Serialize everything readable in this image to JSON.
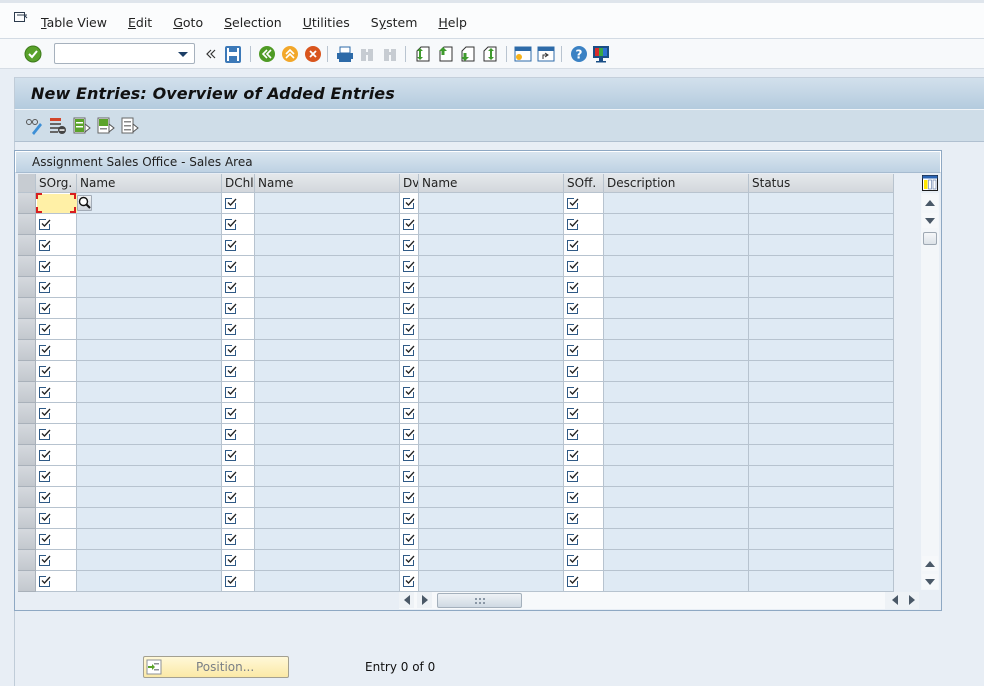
{
  "menubar": {
    "items": [
      {
        "label": "Table View",
        "mnemonic": "T"
      },
      {
        "label": "Edit",
        "mnemonic": "E"
      },
      {
        "label": "Goto",
        "mnemonic": "G"
      },
      {
        "label": "Selection",
        "mnemonic": "S"
      },
      {
        "label": "Utilities",
        "mnemonic": "U"
      },
      {
        "label": "System",
        "mnemonic": "y"
      },
      {
        "label": "Help",
        "mnemonic": "H"
      }
    ]
  },
  "toolbar": {
    "command_field_value": "",
    "icons": [
      "enter-icon",
      "command-field",
      "collapse-icon",
      "save-icon",
      "back-icon",
      "exit-icon",
      "cancel-icon",
      "print-icon",
      "find-icon",
      "find-next-icon",
      "first-page-icon",
      "previous-page-icon",
      "next-page-icon",
      "last-page-icon",
      "create-session-icon",
      "shortcut-icon",
      "help-icon",
      "customize-layout-icon"
    ]
  },
  "page": {
    "title": "New Entries: Overview of Added Entries"
  },
  "app_toolbar": {
    "icons": [
      "display-change-icon",
      "delete-icon",
      "select-all-icon",
      "select-block-icon",
      "deselect-all-icon"
    ]
  },
  "table": {
    "title": "Assignment Sales Office - Sales Area",
    "columns": [
      {
        "key": "sorg",
        "label": "SOrg."
      },
      {
        "key": "sorg_name",
        "label": "Name"
      },
      {
        "key": "dchl",
        "label": "DChl"
      },
      {
        "key": "dchl_name",
        "label": "Name"
      },
      {
        "key": "dv",
        "label": "Dv"
      },
      {
        "key": "dv_name",
        "label": "Name"
      },
      {
        "key": "soff",
        "label": "SOff."
      },
      {
        "key": "description",
        "label": "Description"
      },
      {
        "key": "status",
        "label": "Status"
      }
    ],
    "row_count": 19,
    "rows": [],
    "focused_cell": {
      "row": 0,
      "column": "SOrg."
    }
  },
  "footer": {
    "position_button": "Position...",
    "entry_text": "Entry 0 of 0"
  },
  "colors": {
    "background": "#e8eef5",
    "title_bar": "#bed2e3",
    "focus_cell": "#fff0a6",
    "focus_marker": "#d91e1e",
    "position_button": "#fbe9a6"
  }
}
